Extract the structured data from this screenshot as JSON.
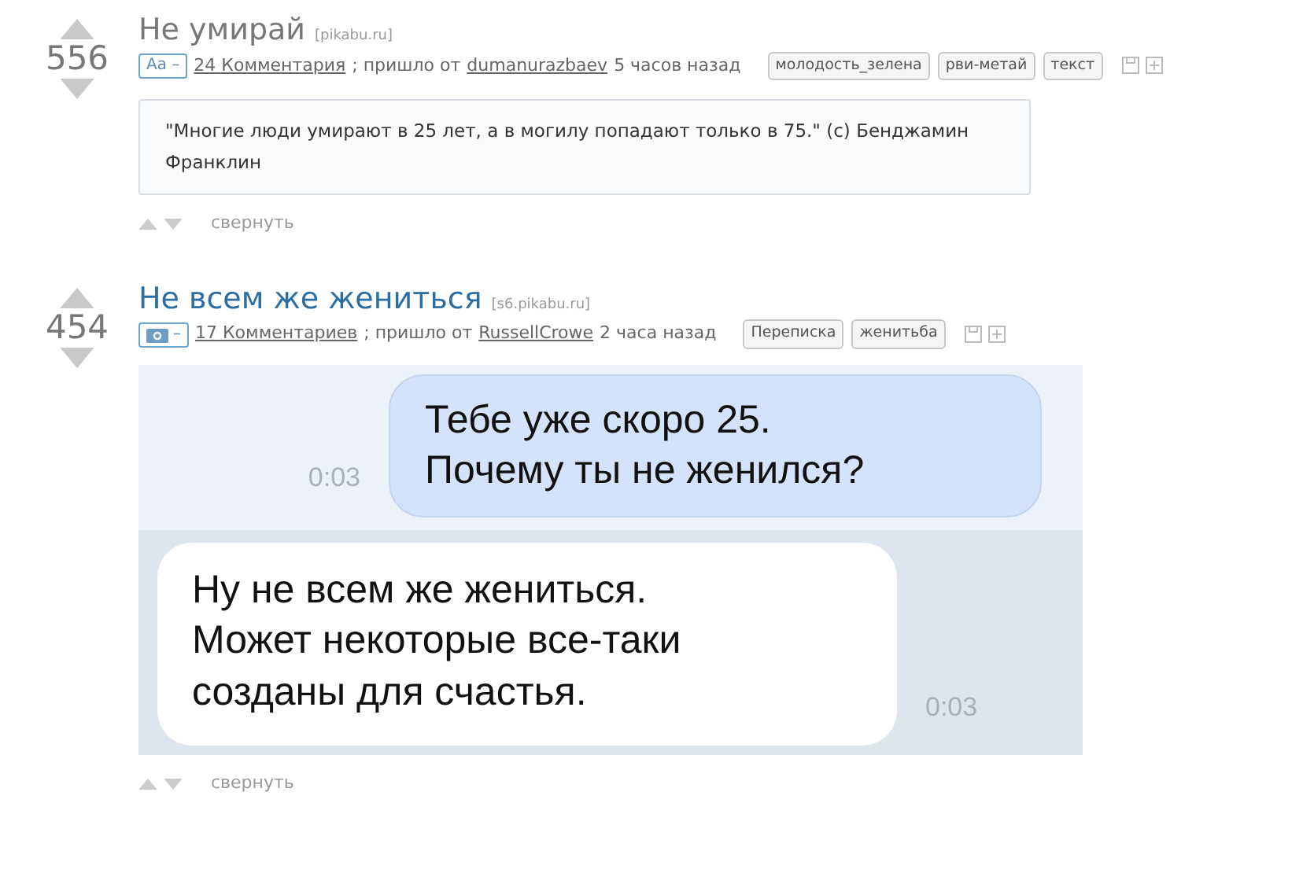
{
  "posts": [
    {
      "rating": "556",
      "title": "Не умирай",
      "visited": true,
      "domain": "[pikabu.ru]",
      "kind": "text",
      "badge": "Aa –",
      "comments": "24 Комментария",
      "from_text": "; пришло от",
      "author": "dumanurazbaev",
      "time": "5 часов назад",
      "tags": [
        "молодость_зелена",
        "рви-метай",
        "текст"
      ],
      "quote": "\"Многие люди умирают в 25 лет, а в могилу попадают только в 75.\" (с) Бенджамин Франклин",
      "collapse": "свернуть"
    },
    {
      "rating": "454",
      "title": "Не всем же жениться",
      "visited": false,
      "domain": "[s6.pikabu.ru]",
      "kind": "image",
      "badge": "–",
      "comments": "17 Комментариев",
      "from_text": "; пришло от",
      "author": "RussellCrowe",
      "time": "2 часа назад",
      "tags": [
        "Переписка",
        "женитьба"
      ],
      "chat": [
        {
          "text": "Тебе уже скоро 25.\nПочему ты не женился?",
          "time": "0:03",
          "outgoing": true
        },
        {
          "text": "Ну не всем же жениться.\nМожет некоторые все-таки\nсозданы для счастья.",
          "time": "0:03",
          "outgoing": false
        }
      ],
      "collapse": "свернуть"
    }
  ]
}
